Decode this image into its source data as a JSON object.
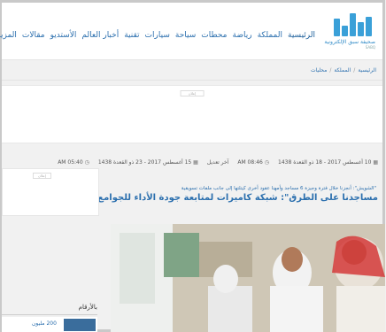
{
  "header": {
    "logo_text": "صحيفة سبق الإلكترونية",
    "nav": [
      "الرئيسية",
      "المملكة",
      "رياضة",
      "محطات",
      "سياحة",
      "سيارات",
      "تقنية",
      "أخبار العالم",
      "الأستديو",
      "مقالات",
      "المزيد"
    ]
  },
  "breadcrumb": {
    "items": [
      "الرئيسية",
      "المملكة",
      "محليات"
    ]
  },
  "ad": {
    "label": "إعلان"
  },
  "sidebar": {
    "ad_label": "إعلان",
    "numbers_title": "بالأرقام",
    "numbers_value": "200 مليون"
  },
  "article": {
    "date_published": "10 أغسطس 2017 - 18 ذو القعدة 1438",
    "time_published": "AM 08:46",
    "updated_label": "آخر تعديل",
    "date_updated": "15 أغسطس 2017 - 23 ذو القعدة 1438",
    "time_updated": "AM 05:40",
    "kicker": "\"الشويش\": أنجزنا خلال فترة وجيزة 6 مساجد وأمهنا عقود أخرى كيتلتها إلى جانب ملفات تسويقية",
    "title": "مساجدنا على الطرق\": شبكة كاميرات لمتابعة جودة الأداء للجوامع الخاضعة لإدارتنا"
  }
}
